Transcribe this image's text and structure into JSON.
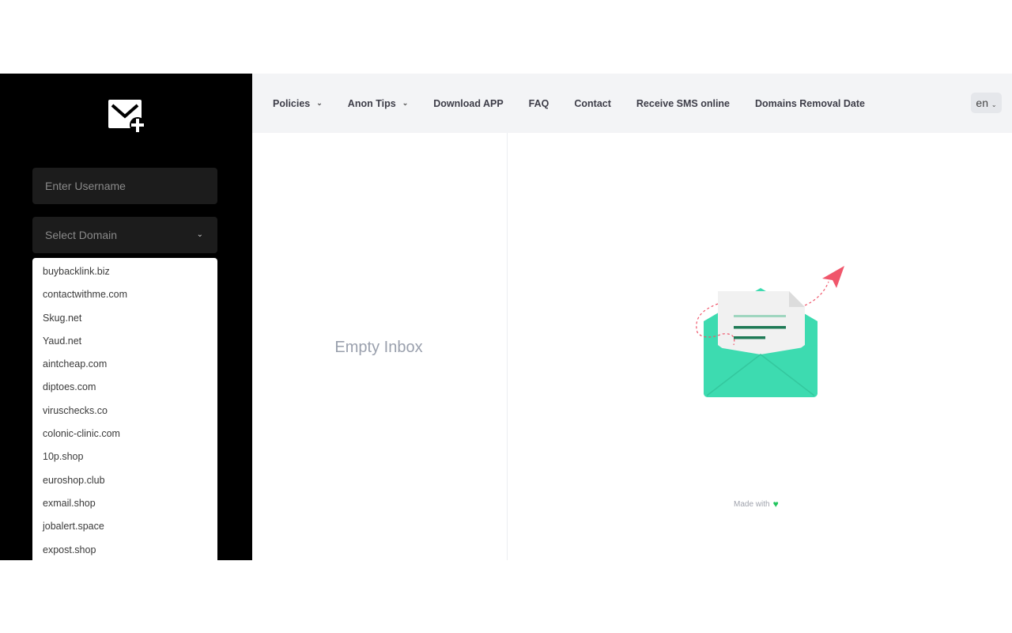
{
  "sidebar": {
    "logo_icon": "mail-plus-icon",
    "username_placeholder": "Enter Username",
    "domain_select_label": "Select Domain",
    "domain_options": [
      "buybacklink.biz",
      "contactwithme.com",
      "Skug.net",
      "Yaud.net",
      "aintcheap.com",
      "diptoes.com",
      "viruschecks.co",
      "colonic-clinic.com",
      "10p.shop",
      "euroshop.club",
      "exmail.shop",
      "jobalert.space",
      "expost.shop"
    ]
  },
  "nav": {
    "items": [
      {
        "label": "Policies",
        "dropdown": true
      },
      {
        "label": "Anon Tips",
        "dropdown": true
      },
      {
        "label": "Download APP",
        "dropdown": false
      },
      {
        "label": "FAQ",
        "dropdown": false
      },
      {
        "label": "Contact",
        "dropdown": false
      },
      {
        "label": "Receive SMS online",
        "dropdown": false
      },
      {
        "label": "Domains Removal Date",
        "dropdown": false
      }
    ],
    "language": "en"
  },
  "inbox": {
    "empty_text": "Empty Inbox"
  },
  "footer": {
    "made_with": "Made with",
    "heart_icon": "heart-icon",
    "heart_color": "#22c55e"
  },
  "colors": {
    "accent": "#3ddbb0",
    "paper_plane": "#f0566b"
  }
}
